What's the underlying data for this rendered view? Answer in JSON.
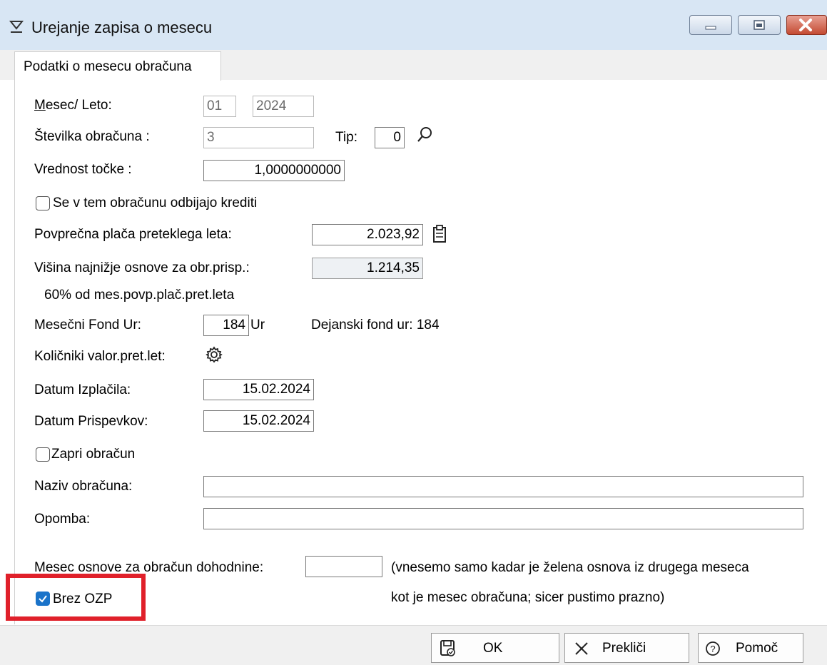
{
  "window": {
    "title": "Urejanje zapisa o mesecu",
    "controls": [
      "minimize",
      "maximize",
      "close"
    ],
    "accent_color": "#d8e6f4",
    "close_color": "#c44a32"
  },
  "tabs": [
    {
      "label": "Podatki o mesecu obračuna",
      "active": true
    }
  ],
  "form": {
    "mesec_leto": {
      "label": "Mesec/ Leto:",
      "mesec": "01",
      "leto": "2024"
    },
    "stevilka": {
      "label": "Številka obračuna :",
      "value": "3",
      "tip_label": "Tip:",
      "tip_value": "0",
      "search_icon": "search-icon"
    },
    "vrednost_tocke": {
      "label": "Vrednost točke :",
      "value": "1,0000000000"
    },
    "krediti": {
      "label": "Se v tem obračunu odbijajo krediti",
      "checked": false
    },
    "povprecna_placa": {
      "label": "Povprečna plača preteklega leta:",
      "value": "2.023,92",
      "paste_icon": "clipboard-icon"
    },
    "visina": {
      "label": "Višina najnižje osnove za obr.prisp.:",
      "value": "1.214,35",
      "note": "60% od mes.povp.plač.pret.leta"
    },
    "fond": {
      "label": "Mesečni Fond Ur:",
      "value": "184",
      "unit": "Ur",
      "dejanski": "Dejanski fond ur: 184"
    },
    "kolicniki": {
      "label": "Količniki valor.pret.let:",
      "icon": "gear-icon"
    },
    "datum_izplacila": {
      "label": "Datum Izplačila:",
      "value": "15.02.2024"
    },
    "datum_prispevkov": {
      "label": "Datum Prispevkov:",
      "value": "15.02.2024"
    },
    "zapri": {
      "label": "Zapri obračun",
      "checked": false
    },
    "naziv": {
      "label": "Naziv obračuna:",
      "value": ""
    },
    "opomba": {
      "label": "Opomba:",
      "value": ""
    },
    "mesec_osnove": {
      "label": "Mesec osnove za obračun dohodnine:",
      "value": "",
      "hint_line1": "(vnesemo samo kadar je želena osnova iz drugega meseca",
      "hint_line2": "kot je mesec obračuna; sicer pustimo prazno)"
    },
    "brez_ozp": {
      "label": "Brez OZP",
      "checked": true,
      "highlight_color": "#e0202a"
    }
  },
  "buttons": {
    "ok": "OK",
    "preklici": "Prekliči",
    "pomoc": "Pomoč"
  }
}
